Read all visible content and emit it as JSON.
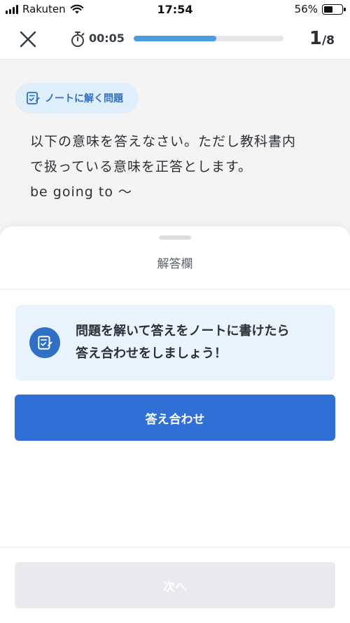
{
  "status_bar": {
    "carrier": "Rakuten",
    "time": "17:54",
    "battery_percent": "56%",
    "battery_level": 0.56,
    "icons": [
      "signal-icon",
      "wifi-icon",
      "battery-icon"
    ]
  },
  "header": {
    "close_icon": "close-icon",
    "timer_icon": "stopwatch-icon",
    "timer": "00:05",
    "progress": 0.55,
    "counter_current": "1",
    "counter_total": "/8"
  },
  "question": {
    "tag_icon": "notebook-check-icon",
    "tag_label": "ノートに解く問題",
    "text_line1": "以下の意味を答えなさい。ただし教科書内",
    "text_line2": "で扱っている意味を正答とします。",
    "text_line3": "be going to 〜"
  },
  "answer_sheet": {
    "title": "解答欄",
    "info_icon": "notebook-check-icon",
    "info_line1": "問題を解いて答えをノートに書けたら",
    "info_line2": "答え合わせをしましょう！",
    "check_button": "答え合わせ",
    "next_button": "次へ"
  },
  "colors": {
    "primary": "#2f6fd6",
    "progress": "#4a9be0",
    "tag_bg": "#dfeefb",
    "info_bg": "#e9f3fd",
    "disabled": "#e8eaed"
  }
}
